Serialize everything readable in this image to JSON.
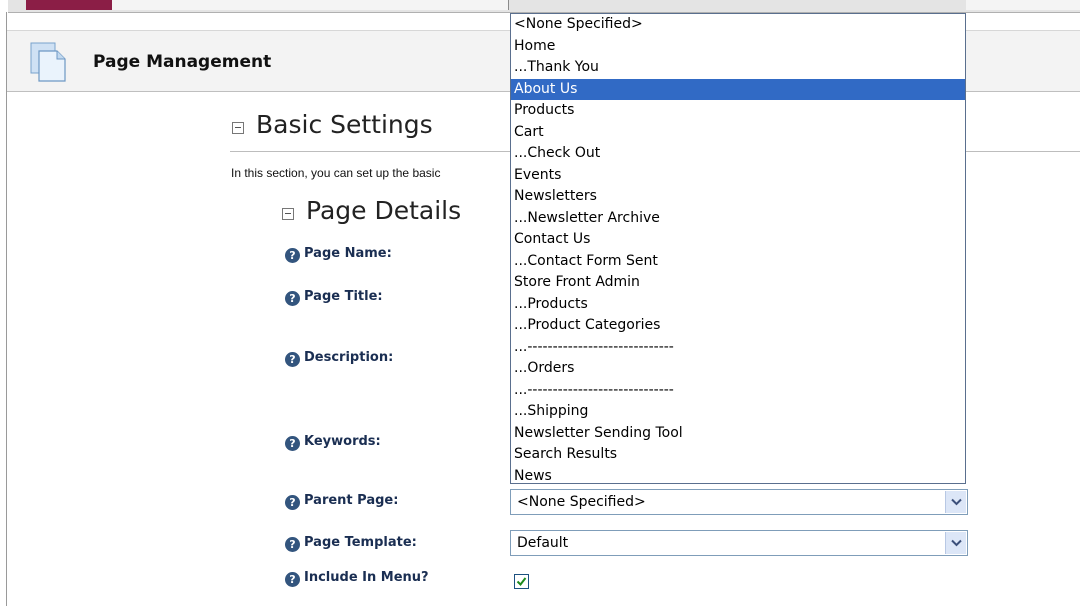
{
  "tabs": [
    {
      "active": true
    },
    {
      "active": false
    },
    {
      "active": false
    },
    {
      "active": false
    },
    {
      "active": false
    },
    {
      "active": false
    },
    {
      "active": false
    },
    {
      "active": false
    },
    {
      "active": false
    },
    {
      "active": false
    }
  ],
  "header": {
    "title": "Page Management",
    "icon": "pages-icon"
  },
  "basic_settings": {
    "title": "Basic Settings",
    "description": "In this section, you can set up the basic"
  },
  "page_details": {
    "title": "Page Details"
  },
  "fields": {
    "page_name": "Page Name:",
    "page_title": "Page Title:",
    "description": "Description:",
    "keywords": "Keywords:",
    "parent_page": "Parent Page:",
    "page_template": "Page Template:",
    "include_in_menu": "Include In Menu?"
  },
  "parent_page": {
    "value": "<None Specified>",
    "options": [
      "<None Specified>",
      "Home",
      "...Thank You",
      "About Us",
      "Products",
      "Cart",
      "...Check Out",
      "Events",
      "Newsletters",
      "...Newsletter Archive",
      "Contact Us",
      "...Contact Form Sent",
      "Store Front Admin",
      "...Products",
      "...Product Categories",
      "...-----------------------------",
      "...Orders",
      "...-----------------------------",
      "...Shipping",
      "Newsletter Sending Tool",
      "Search Results",
      "News"
    ],
    "highlighted_index": 3
  },
  "page_template": {
    "value": "Default"
  },
  "include_in_menu": {
    "checked": true
  },
  "colors": {
    "active_tab": "#8b1e46",
    "label_text": "#1a2e52",
    "highlight": "#316ac5",
    "help_icon": "#33557e"
  }
}
